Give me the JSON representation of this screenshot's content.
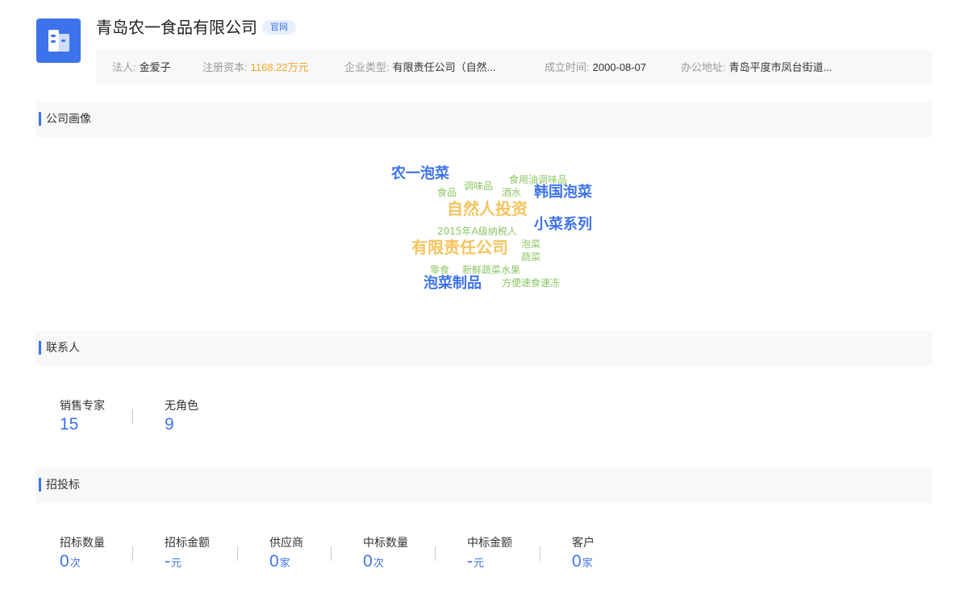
{
  "company": {
    "name": "青岛农一食品有限公司",
    "official_site_label": "官网",
    "logo_icon": "building-icon",
    "logo_color": "#3d73ea"
  },
  "info": {
    "legal_rep_label": "法人:",
    "legal_rep": "金爱子",
    "capital_label": "注册资本:",
    "capital": "1168.22万元",
    "type_label": "企业类型:",
    "type": "有限责任公司（自然...",
    "founded_label": "成立时间:",
    "founded": "2000-08-07",
    "address_label": "办公地址:",
    "address": "青岛平度市凤台街道..."
  },
  "portrait": {
    "title": "公司画像",
    "tags": [
      {
        "text": "农一泡菜",
        "color": "#3d73ea"
      },
      {
        "text": "调味品",
        "color": "#8cc665"
      },
      {
        "text": "食用油调味品",
        "color": "#8cc665"
      },
      {
        "text": "食品",
        "color": "#8cc665"
      },
      {
        "text": "酒水",
        "color": "#8cc665"
      },
      {
        "text": "韩国泡菜",
        "color": "#3d73ea"
      },
      {
        "text": "自然人投资",
        "color": "#f5c45e"
      },
      {
        "text": "2015年A级纳税人",
        "color": "#8cc665"
      },
      {
        "text": "小菜系列",
        "color": "#3d73ea"
      },
      {
        "text": "有限责任公司",
        "color": "#f5c45e"
      },
      {
        "text": "泡菜",
        "color": "#8cc665"
      },
      {
        "text": "蔬菜",
        "color": "#8cc665"
      },
      {
        "text": "零食",
        "color": "#8cc665"
      },
      {
        "text": "新鲜蔬菜水果",
        "color": "#8cc665"
      },
      {
        "text": "泡菜制品",
        "color": "#3d73ea"
      },
      {
        "text": "方便速食速冻",
        "color": "#8cc665"
      }
    ]
  },
  "contacts": {
    "title": "联系人",
    "stats": [
      {
        "label": "销售专家",
        "value": "15"
      },
      {
        "label": "无角色",
        "value": "9"
      }
    ]
  },
  "bidding": {
    "title": "招投标",
    "stats": [
      {
        "label": "招标数量",
        "value": "0",
        "unit": "次"
      },
      {
        "label": "招标金额",
        "value": "-",
        "unit": "元"
      },
      {
        "label": "供应商",
        "value": "0",
        "unit": "家"
      },
      {
        "label": "中标数量",
        "value": "0",
        "unit": "次"
      },
      {
        "label": "中标金额",
        "value": "-",
        "unit": "元"
      },
      {
        "label": "客户",
        "value": "0",
        "unit": "家"
      }
    ]
  }
}
